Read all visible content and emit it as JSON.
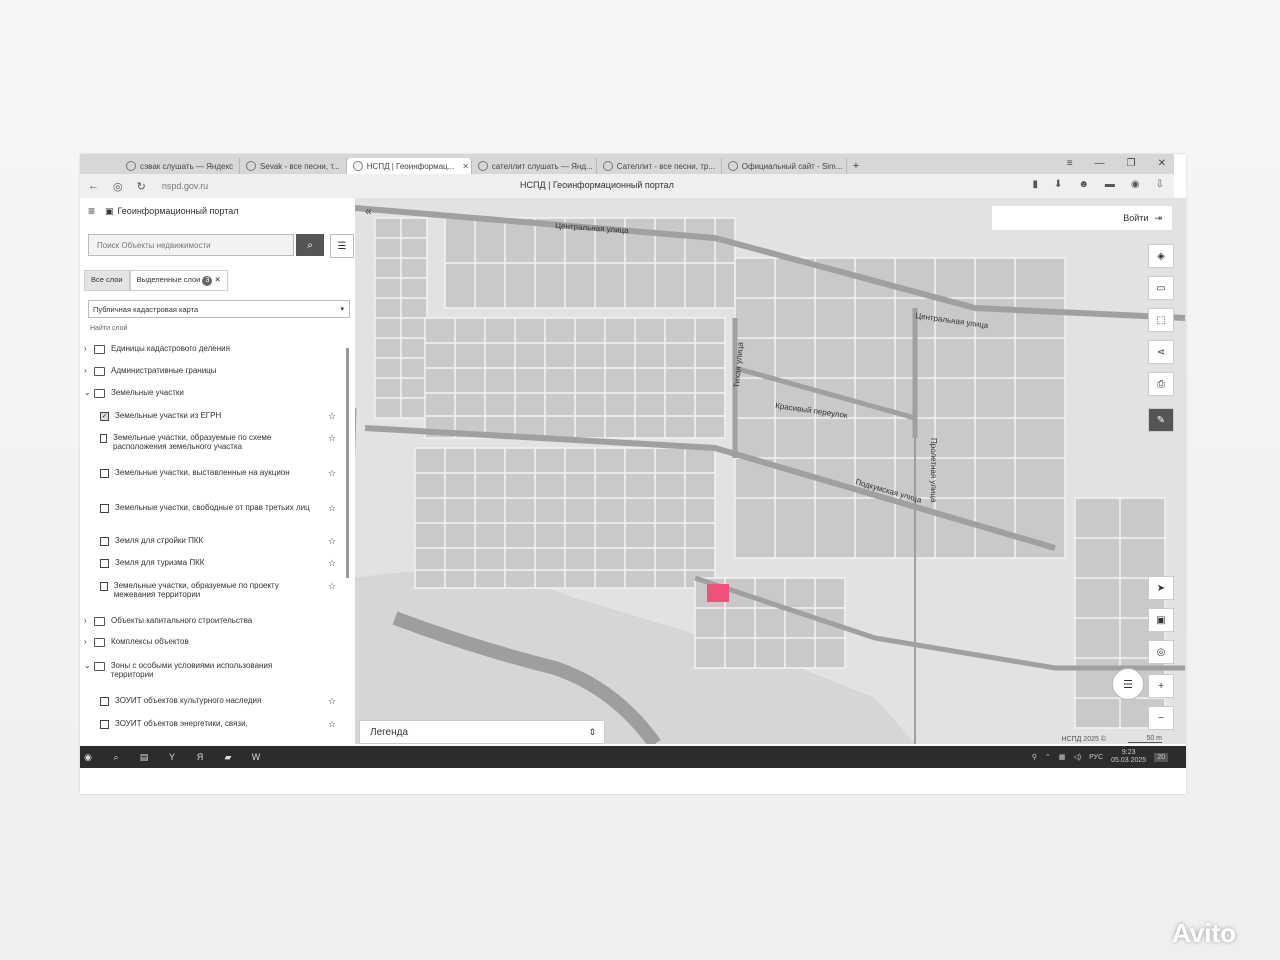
{
  "browser": {
    "tabs": [
      {
        "label": "сэвак слушать — Яндекс",
        "active": false
      },
      {
        "label": "Sevak - все песни, т...",
        "active": false
      },
      {
        "label": "НСПД | Геоинформац...",
        "active": true
      },
      {
        "label": "сателлит слушать — Янд...",
        "active": false
      },
      {
        "label": "Сателлит - все песни, тр...",
        "active": false
      },
      {
        "label": "Официальный сайт - Sim...",
        "active": false
      }
    ],
    "new_tab": "+",
    "url": "nspd.gov.ru",
    "page_title": "НСПД | Геоинформационный портал"
  },
  "sidebar": {
    "title": "Геоинформационный портал",
    "search_placeholder": "Поиск Объекты недвижимости",
    "tab_all": "Все слои",
    "tab_selected": "Выделенные слои",
    "selected_count": "3",
    "map_select": "Публичная кадастровая карта",
    "find_layer": "Найти слой",
    "tree": [
      {
        "label": "Единицы кадастрового деления",
        "kind": "folder",
        "expanded": false
      },
      {
        "label": "Административные границы",
        "kind": "folder",
        "expanded": false
      },
      {
        "label": "Земельные участки",
        "kind": "folder",
        "expanded": true
      },
      {
        "label": "Земельные участки из ЕГРН",
        "kind": "item",
        "checked": true
      },
      {
        "label": "Земельные участки, образуемые по схеме расположения земельного участка",
        "kind": "item",
        "checked": false
      },
      {
        "label": "Земельные участки, выставленные на аукцион",
        "kind": "item",
        "checked": false
      },
      {
        "label": "Земельные участки, свободные от прав третьих лиц",
        "kind": "item",
        "checked": false
      },
      {
        "label": "Земля для стройки ПКК",
        "kind": "item",
        "checked": false
      },
      {
        "label": "Земля для туризма ПКК",
        "kind": "item",
        "checked": false
      },
      {
        "label": "Земельные участки, образуемые по проекту межевания территории",
        "kind": "item",
        "checked": false
      },
      {
        "label": "Объекты капитального строительства",
        "kind": "folder",
        "expanded": false
      },
      {
        "label": "Комплексы объектов",
        "kind": "folder",
        "expanded": false
      },
      {
        "label": "Зоны с особыми условиями использования территории",
        "kind": "folder",
        "expanded": true
      },
      {
        "label": "ЗОУИТ объектов культурного наследия",
        "kind": "item",
        "checked": false
      },
      {
        "label": "ЗОУИТ объектов энергетики, связи,",
        "kind": "item",
        "checked": false
      }
    ]
  },
  "map": {
    "login": "Войти",
    "streets": [
      "Центральная улица",
      "Центральная улица",
      "Тихая улица",
      "Красивый переулок",
      "Пролетная улица",
      "Подкумская улица"
    ],
    "legend": "Легенда",
    "copyright": "НСПД 2025 ©",
    "scale": "50 m",
    "highlight_color": "#f0507a"
  },
  "taskbar": {
    "lang": "РУС",
    "time": "9:23",
    "date": "05.03.2025",
    "notifications": "20"
  },
  "watermark": "Avito"
}
